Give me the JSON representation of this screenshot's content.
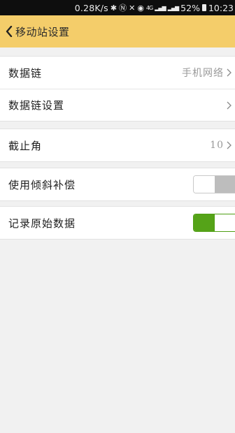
{
  "status_bar": {
    "speed": "0.28K/s",
    "icons": [
      "bluetooth-icon",
      "nfc-icon",
      "mute-icon",
      "alarm-icon",
      "4g-icon",
      "signal-icon",
      "signal-icon",
      "battery-icon"
    ],
    "network": "4G",
    "battery": "52%",
    "time": "10:23"
  },
  "header": {
    "title": "移动站设置"
  },
  "group1": {
    "rows": [
      {
        "label": "数据链",
        "value": "手机网络"
      },
      {
        "label": "数据链设置",
        "value": ""
      }
    ]
  },
  "group2": {
    "rows": [
      {
        "label": "截止角",
        "value": "10"
      }
    ]
  },
  "group3": {
    "rows": [
      {
        "label": "使用倾斜补偿",
        "toggle": false
      }
    ]
  },
  "group4": {
    "rows": [
      {
        "label": "记录原始数据",
        "toggle": true
      }
    ]
  },
  "colors": {
    "header_bg": "#f4cd6a",
    "toggle_on": "#55a318",
    "toggle_off": "#bdbdbd",
    "page_bg": "#f1f1f1"
  }
}
